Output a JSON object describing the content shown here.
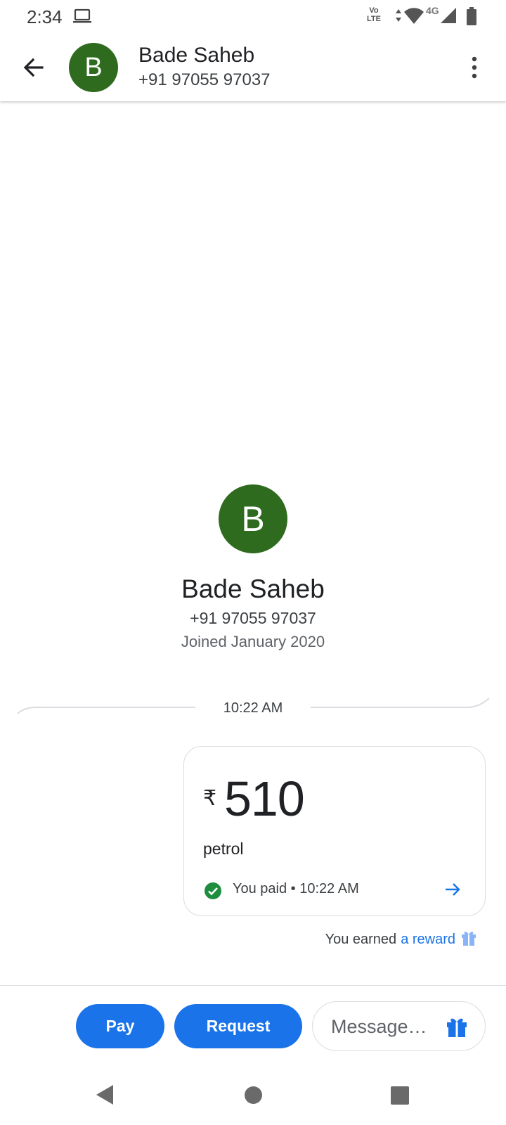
{
  "status_bar": {
    "time": "2:34",
    "network_type": "4G",
    "volte_top": "Vo",
    "volte_bottom": "LTE",
    "icons": [
      "laptop-icon",
      "volte-icon",
      "data-arrows-icon",
      "wifi-icon",
      "signal-icon",
      "battery-icon"
    ]
  },
  "header": {
    "avatar_letter": "B",
    "name": "Bade Saheb",
    "phone": "+91 97055 97037",
    "avatar_color": "#2e6b1f"
  },
  "profile": {
    "avatar_letter": "B",
    "name": "Bade Saheb",
    "phone": "+91 97055 97037",
    "joined": "Joined January 2020"
  },
  "conversation": {
    "time_label": "10:22 AM",
    "payment": {
      "currency_symbol": "₹",
      "amount": "510",
      "note": "petrol",
      "status": "You paid • 10:22 AM",
      "status_color": "#1e8e3e"
    },
    "reward": {
      "prefix": "You earned",
      "link": "a reward"
    }
  },
  "actions": {
    "pay_label": "Pay",
    "request_label": "Request",
    "message_placeholder": "Message…",
    "accent_color": "#1a73e8"
  }
}
